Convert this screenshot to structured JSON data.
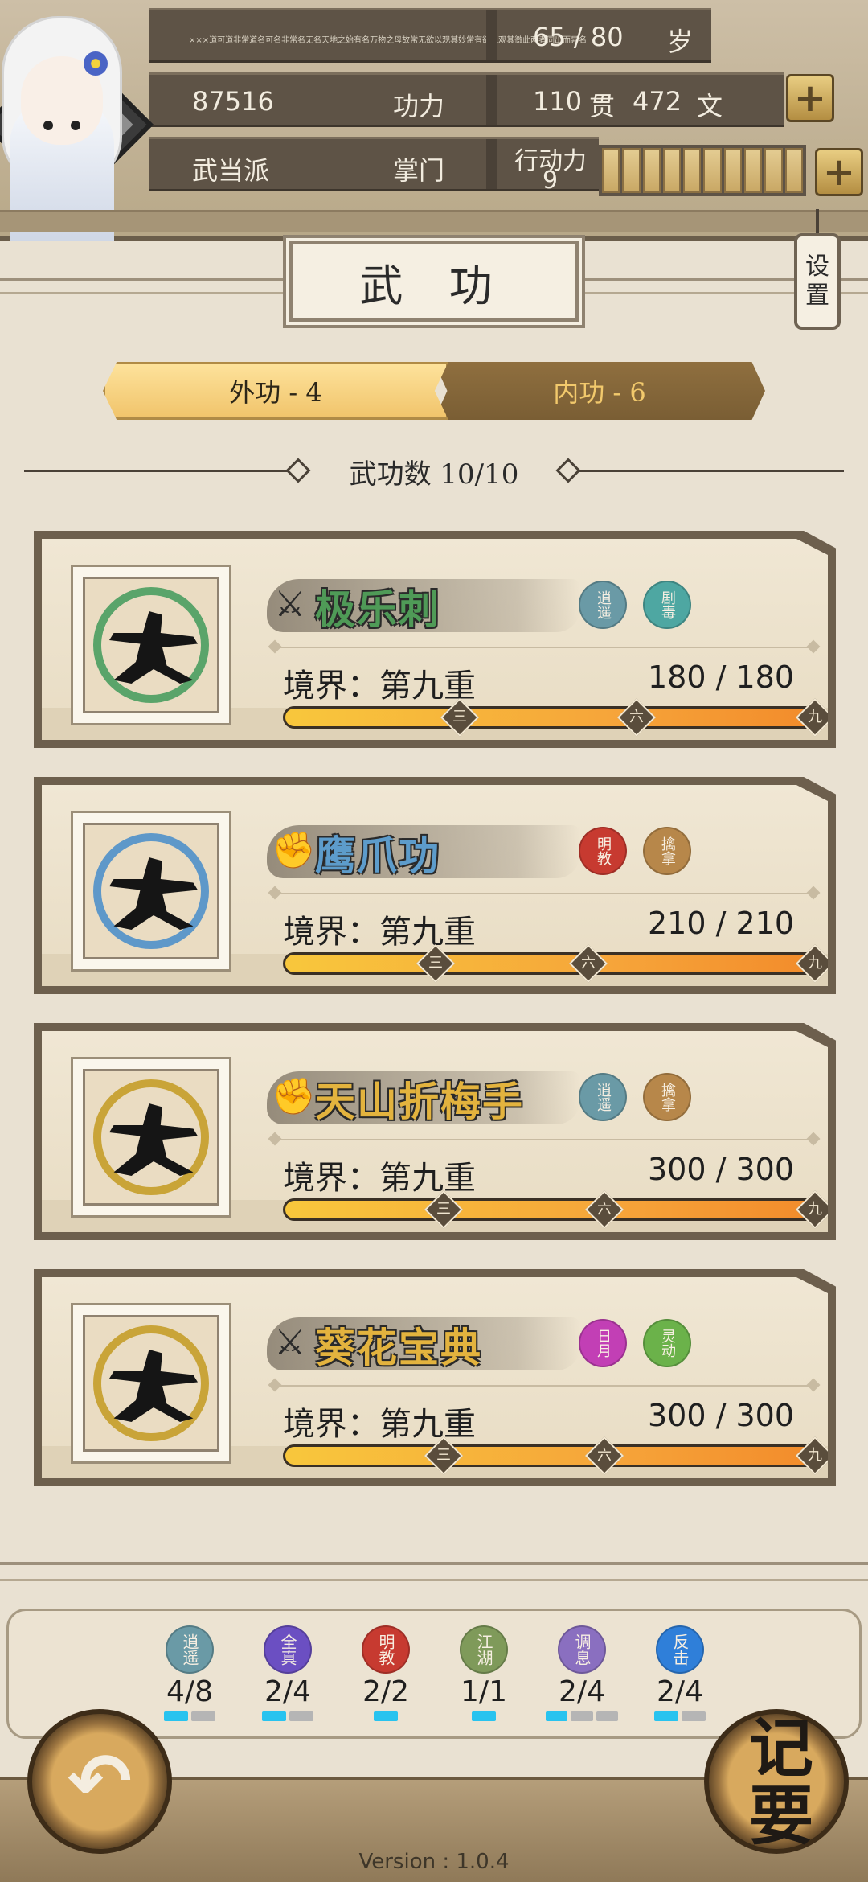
{
  "header": {
    "bio": "×××道可道非常道名可名非常名无名天地之始有名万物之母故常无欲以观其妙常有欲以观其徼此两者同出而异名",
    "age": "65 / 80",
    "age_unit": "岁",
    "power_value": "87516",
    "power_label": "功力",
    "money_guan": "110",
    "money_guan_unit": "贯",
    "money_wen": "472",
    "money_wen_unit": "文",
    "sect": "武当派",
    "rank": "掌门",
    "stamina_label": "行动力",
    "stamina_value": "9",
    "stamina_segments": 10,
    "plus_glyph": "+"
  },
  "page": {
    "title": "武 功",
    "settings_line1": "设",
    "settings_line2": "置"
  },
  "tabs": {
    "outer": "外功 - 4",
    "inner": "内功 - 6"
  },
  "count_text": "武功数 10/10",
  "skills": [
    {
      "name": "极乐刺",
      "weapon_icon": "sword-icon",
      "weapon_glyph": "⚔",
      "name_color": "#4f9a57",
      "ring_color": "#5aa46a",
      "badge1": "逍遥",
      "badge1_color": "#6a9aa6",
      "badge2": "剧毒",
      "badge2_color": "#4ea7a2",
      "realm": "境界：第九重",
      "progress": "180 / 180",
      "fill": 1.0,
      "marks": [
        "三",
        "六",
        "九"
      ]
    },
    {
      "name": "鹰爪功",
      "weapon_icon": "fist-icon",
      "weapon_glyph": "✊",
      "name_color": "#5d9ccb",
      "ring_color": "#5e98c9",
      "badge1": "明教",
      "badge1_color": "#c73a30",
      "badge2": "擒拿",
      "badge2_color": "#b7874a",
      "realm": "境界：第九重",
      "progress": "210 / 210",
      "fill": 1.0,
      "marks": [
        "三",
        "六",
        "九"
      ]
    },
    {
      "name": "天山折梅手",
      "weapon_icon": "fist-icon",
      "weapon_glyph": "✊",
      "name_color": "#e3b33e",
      "ring_color": "#c9a438",
      "badge1": "逍遥",
      "badge1_color": "#6a9aa6",
      "badge2": "擒拿",
      "badge2_color": "#b7874a",
      "realm": "境界：第九重",
      "progress": "300 / 300",
      "fill": 1.0,
      "marks": [
        "三",
        "六",
        "九"
      ]
    },
    {
      "name": "葵花宝典",
      "weapon_icon": "sword-icon",
      "weapon_glyph": "⚔",
      "name_color": "#e3b33e",
      "ring_color": "#c9a438",
      "badge1": "日月",
      "badge1_color": "#c23fb5",
      "badge2": "灵动",
      "badge2_color": "#6bb24a",
      "realm": "境界：第九重",
      "progress": "300 / 300",
      "fill": 1.0,
      "marks": [
        "三",
        "六",
        "九"
      ]
    }
  ],
  "schools": [
    {
      "name": "逍遥",
      "color": "#6a9aa6",
      "count": "4/8",
      "pips_on": 1,
      "pips_total": 2
    },
    {
      "name": "全真",
      "color": "#6b4fc2",
      "count": "2/4",
      "pips_on": 1,
      "pips_total": 2
    },
    {
      "name": "明教",
      "color": "#c73a30",
      "count": "2/2",
      "pips_on": 1,
      "pips_total": 1
    },
    {
      "name": "江湖",
      "color": "#7f9a5a",
      "count": "1/1",
      "pips_on": 1,
      "pips_total": 1
    },
    {
      "name": "调息",
      "color": "#8a6fc0",
      "count": "2/4",
      "pips_on": 1,
      "pips_total": 3
    },
    {
      "name": "反击",
      "color": "#2f7fd9",
      "count": "2/4",
      "pips_on": 1,
      "pips_total": 2
    }
  ],
  "buttons": {
    "back_glyph": "↶",
    "notes": "记要"
  },
  "version": "Version : 1.0.4"
}
